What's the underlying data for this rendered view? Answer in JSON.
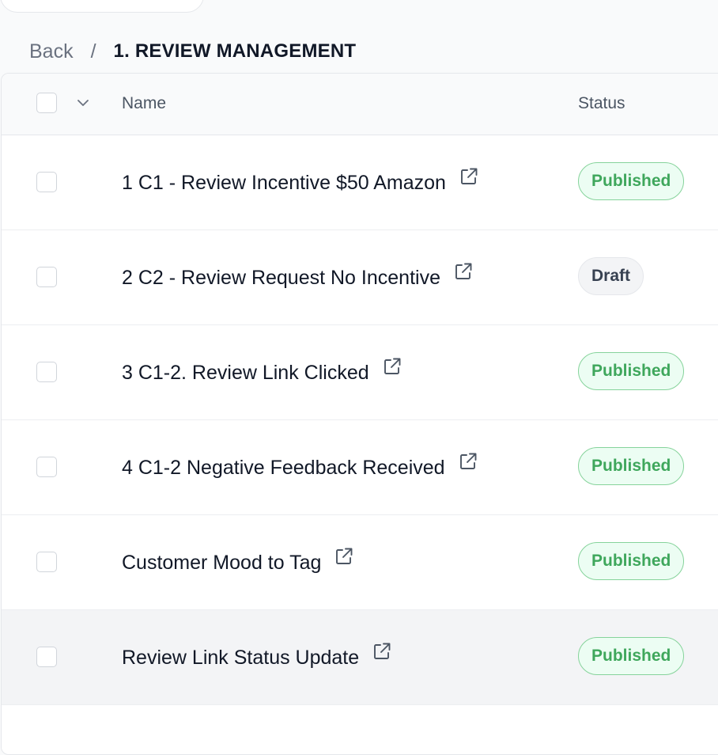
{
  "breadcrumb": {
    "back_label": "Back",
    "separator": "/",
    "current": "1. REVIEW MANAGEMENT"
  },
  "table": {
    "columns": {
      "name": "Name",
      "status": "Status"
    },
    "rows": [
      {
        "name": "1 C1 - Review Incentive $50 Amazon",
        "status": "Published",
        "status_type": "published"
      },
      {
        "name": "2 C2 - Review Request No Incentive",
        "status": "Draft",
        "status_type": "draft"
      },
      {
        "name": "3 C1-2. Review Link Clicked",
        "status": "Published",
        "status_type": "published"
      },
      {
        "name": "4 C1-2 Negative Feedback Received",
        "status": "Published",
        "status_type": "published"
      },
      {
        "name": "Customer Mood to Tag",
        "status": "Published",
        "status_type": "published"
      },
      {
        "name": "Review Link Status Update",
        "status": "Published",
        "status_type": "published"
      }
    ]
  },
  "colors": {
    "published_text": "#3fa75c",
    "published_bg": "#ecfdf3",
    "draft_text": "#374151"
  },
  "icons": [
    "chevron-down-icon",
    "external-link-icon"
  ]
}
